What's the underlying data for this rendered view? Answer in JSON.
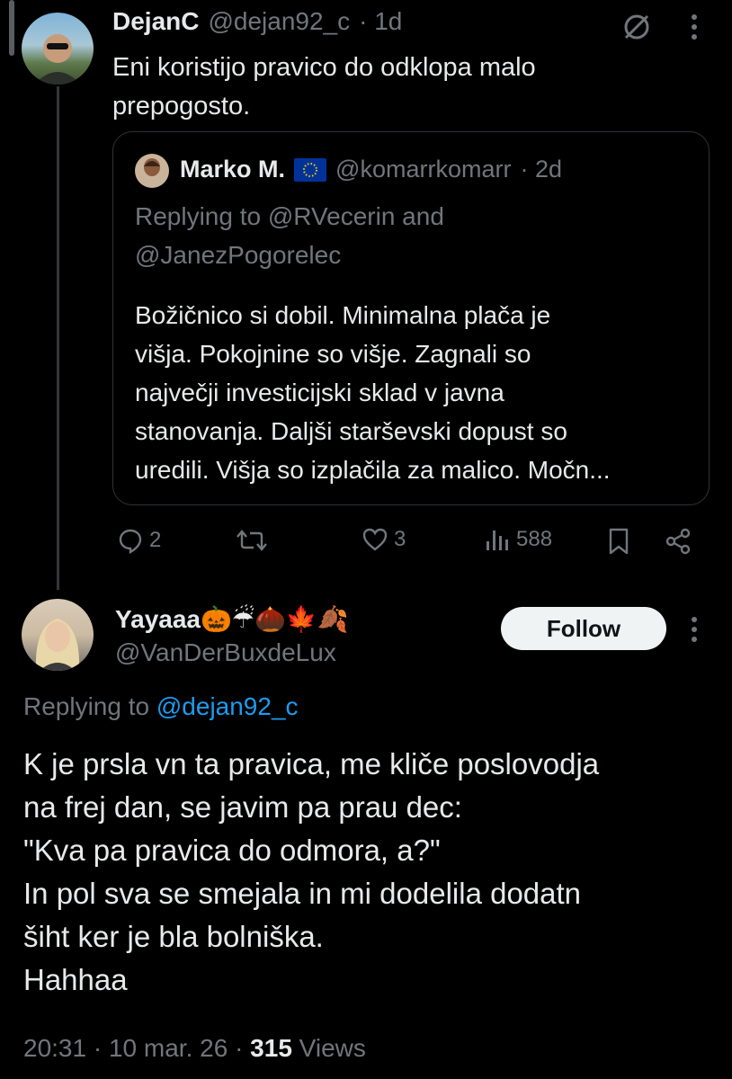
{
  "parent_tweet": {
    "name": "DejanC",
    "handle": "@dejan92_c",
    "time": "· 1d",
    "text": "Eni koristijo pravico do odklopa malo prepogosto.",
    "quoted": {
      "name": "Marko M.",
      "handle": "@komarrkomarr",
      "time": "· 2d",
      "replying_line1": "Replying to @RVecerin and",
      "replying_line2": "@JanezPogorelec",
      "text_lines": [
        "Božičnico si dobil. Minimalna plača je",
        "višja. Pokojnine so višje. Zagnali so",
        "največji investicijski sklad v javna",
        "stanovanja. Daljši starševski dopust so",
        "uredili. Višja so izplačila za malico. Močn..."
      ]
    },
    "actions": {
      "replies": "2",
      "likes": "3",
      "views": "588"
    }
  },
  "main_tweet": {
    "name": "Yayaaa🎃☔🌰🍁🍂",
    "handle": "@VanDerBuxdeLux",
    "follow_label": "Follow",
    "replying_prefix": "Replying to",
    "replying_handle": "@dejan92_c",
    "text": "K je prsla vn ta pravica, me kliče poslovodja\nna frej dan, se javim pa prau dec:\n\"Kva pa pravica do odmora, a?\"\nIn pol sva se smejala in mi dodelila dodatn\nšiht ker je bla bolniška.\nHahhaa",
    "time": "20:31",
    "date": "10 mar. 26",
    "views_count": "315",
    "views_label": "Views"
  },
  "colors": {
    "background": "#000000",
    "text": "#e7e9ea",
    "muted": "#71767b",
    "link": "#1d9bf0",
    "eu_flag": "#003399"
  }
}
